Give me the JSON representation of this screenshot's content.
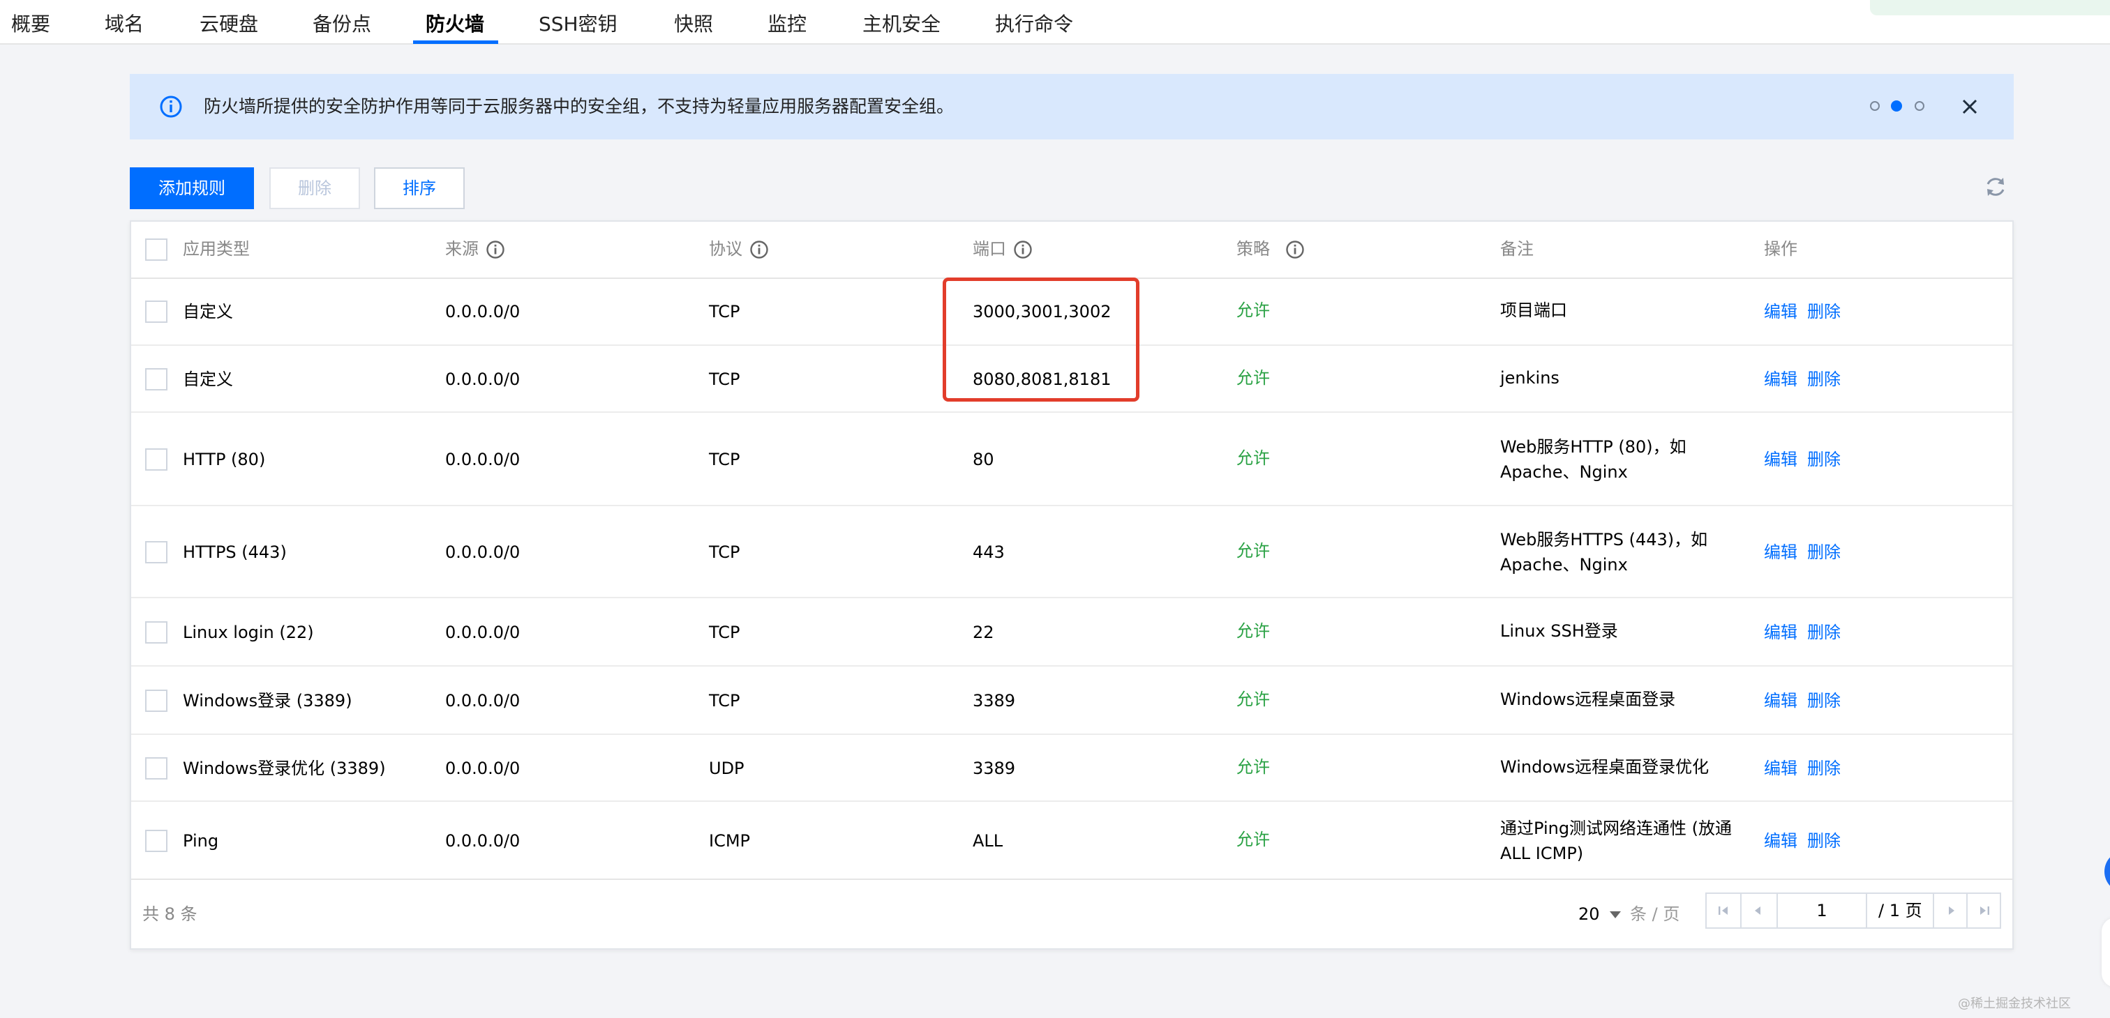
{
  "nav": {
    "tabs": [
      {
        "label": "概要"
      },
      {
        "label": "域名"
      },
      {
        "label": "云硬盘"
      },
      {
        "label": "备份点"
      },
      {
        "label": "防火墙",
        "active": true
      },
      {
        "label": "SSH密钥"
      },
      {
        "label": "快照"
      },
      {
        "label": "监控"
      },
      {
        "label": "主机安全"
      },
      {
        "label": "执行命令"
      }
    ]
  },
  "banner": {
    "text": "防火墙所提供的安全防护作用等同于云服务器中的安全组，不支持为轻量应用服务器配置安全组。",
    "icon": "info-circle-icon",
    "carousel_count": 3,
    "carousel_active": 2
  },
  "toolbar": {
    "add_label": "添加规则",
    "delete_label": "删除",
    "sort_label": "排序",
    "refresh_icon": "refresh-icon"
  },
  "table": {
    "headers": {
      "type": "应用类型",
      "source": "来源",
      "protocol": "协议",
      "port": "端口",
      "policy": "策略",
      "note": "备注",
      "action": "操作"
    },
    "edit_label": "编辑",
    "delete_label": "删除",
    "rows": [
      {
        "type": "自定义",
        "source": "0.0.0.0/0",
        "protocol": "TCP",
        "port": "3000,3001,3002",
        "policy": "允许",
        "note": "项目端口",
        "note2": ""
      },
      {
        "type": "自定义",
        "source": "0.0.0.0/0",
        "protocol": "TCP",
        "port": "8080,8081,8181",
        "policy": "允许",
        "note": "jenkins",
        "note2": ""
      },
      {
        "type": "HTTP (80)",
        "source": "0.0.0.0/0",
        "protocol": "TCP",
        "port": "80",
        "policy": "允许",
        "note": "Web服务HTTP (80)，如",
        "note2": "Apache、Nginx"
      },
      {
        "type": "HTTPS (443)",
        "source": "0.0.0.0/0",
        "protocol": "TCP",
        "port": "443",
        "policy": "允许",
        "note": "Web服务HTTPS (443)，如",
        "note2": "Apache、Nginx"
      },
      {
        "type": "Linux login (22)",
        "source": "0.0.0.0/0",
        "protocol": "TCP",
        "port": "22",
        "policy": "允许",
        "note": "Linux SSH登录",
        "note2": ""
      },
      {
        "type": "Windows登录 (3389)",
        "source": "0.0.0.0/0",
        "protocol": "TCP",
        "port": "3389",
        "policy": "允许",
        "note": "Windows远程桌面登录",
        "note2": ""
      },
      {
        "type": "Windows登录优化 (3389)",
        "source": "0.0.0.0/0",
        "protocol": "UDP",
        "port": "3389",
        "policy": "允许",
        "note": "Windows远程桌面登录优化",
        "note2": ""
      },
      {
        "type": "Ping",
        "source": "0.0.0.0/0",
        "protocol": "ICMP",
        "port": "ALL",
        "policy": "允许",
        "note": "通过Ping测试网络连通性 (放通",
        "note2": "ALL ICMP)"
      }
    ]
  },
  "pagination": {
    "total_text": "共 8 条",
    "page_size": "20",
    "per_page_label": "条 / 页",
    "current_page": "1",
    "total_pages": "/ 1 页"
  },
  "colors": {
    "primary": "#006eff",
    "allow": "#2ba245",
    "highlight": "#e23d2b",
    "banner_bg": "#d9e8fd"
  },
  "watermark": "@稀土掘金技术社区"
}
